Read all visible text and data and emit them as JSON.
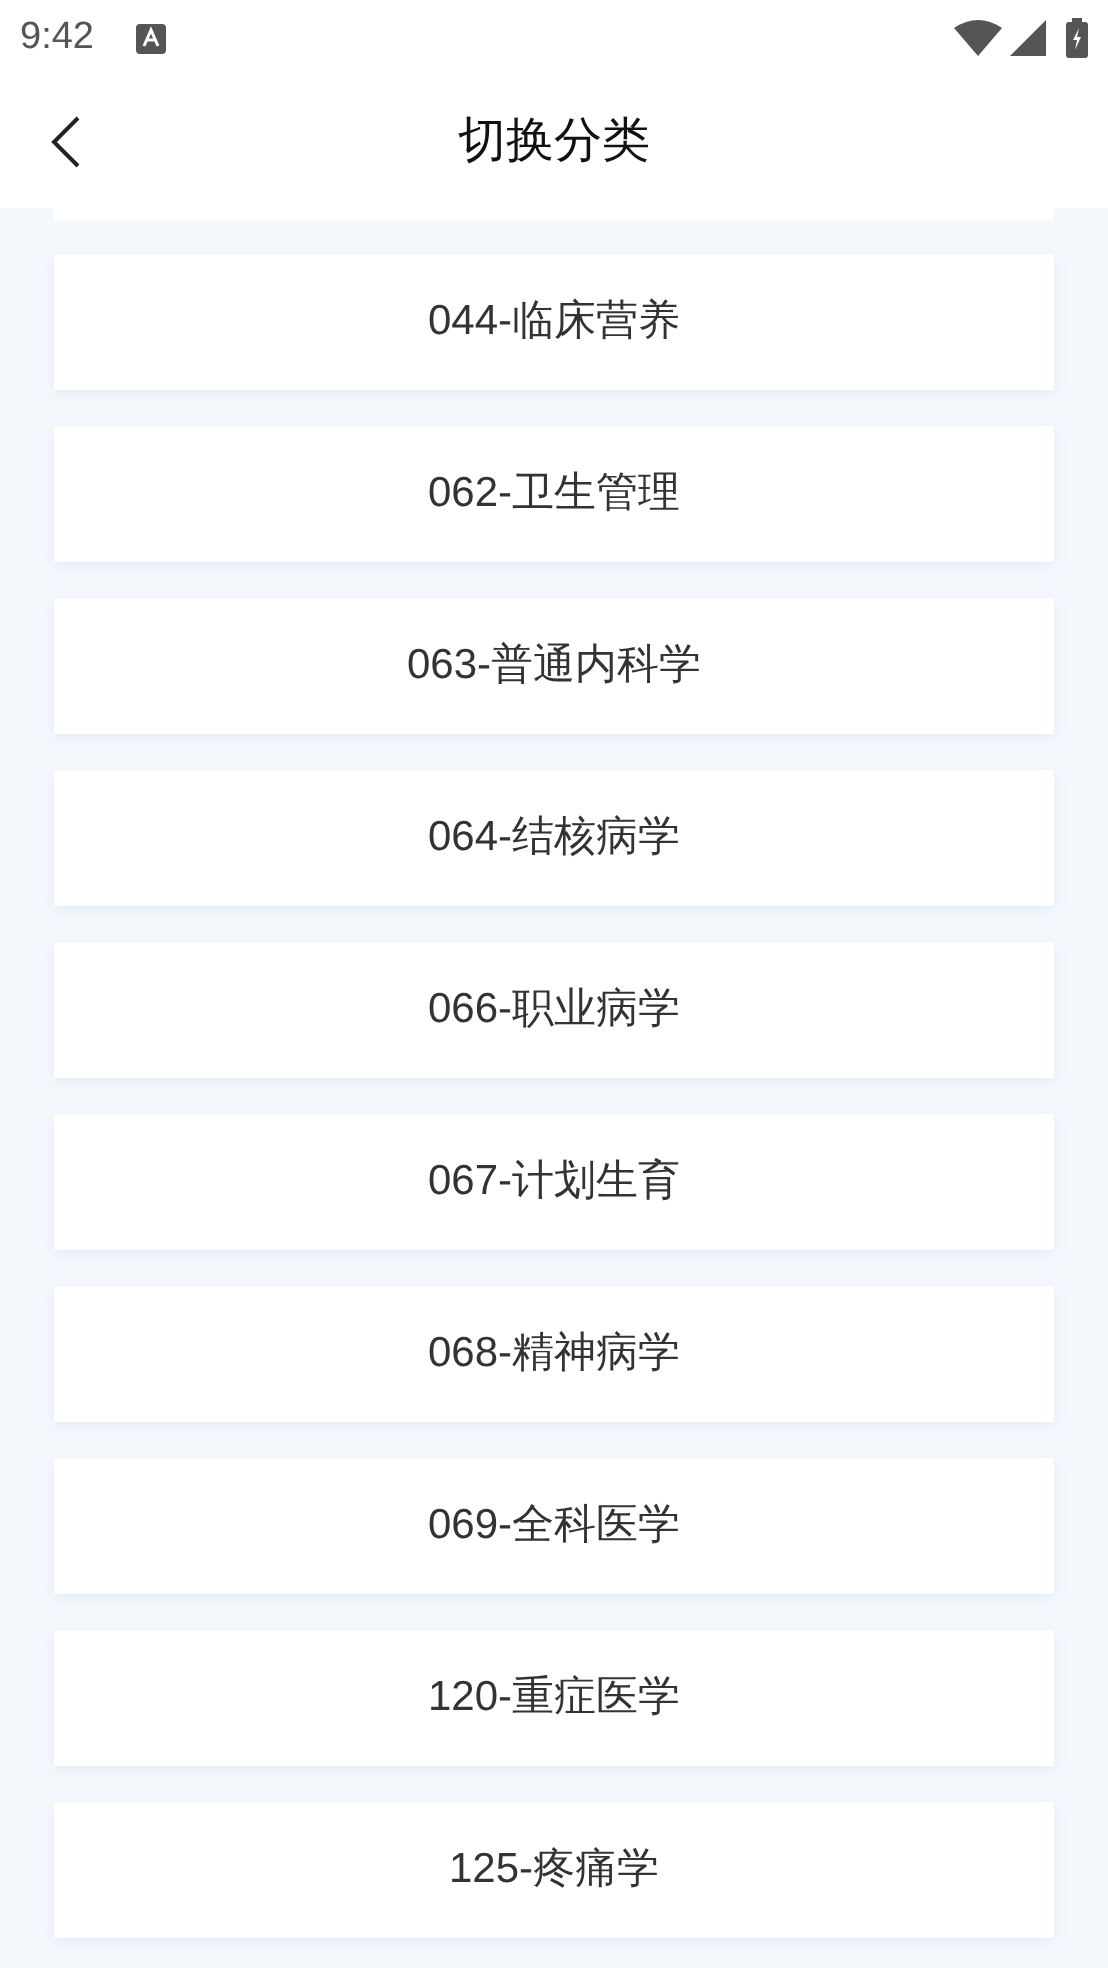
{
  "status_bar": {
    "time": "9:42"
  },
  "header": {
    "title": "切换分类"
  },
  "categories": [
    {
      "label": "044-临床营养"
    },
    {
      "label": "062-卫生管理"
    },
    {
      "label": "063-普通内科学"
    },
    {
      "label": "064-结核病学"
    },
    {
      "label": "066-职业病学"
    },
    {
      "label": "067-计划生育"
    },
    {
      "label": "068-精神病学"
    },
    {
      "label": "069-全科医学"
    },
    {
      "label": "120-重症医学"
    },
    {
      "label": "125-疼痛学"
    }
  ]
}
